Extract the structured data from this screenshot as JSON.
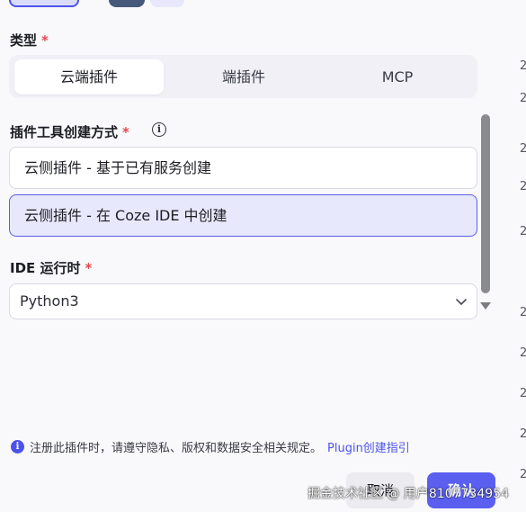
{
  "type_section": {
    "label": "类型",
    "required_mark": "*",
    "tabs": [
      {
        "label": "云端插件",
        "active": true
      },
      {
        "label": "端插件",
        "active": false
      },
      {
        "label": "MCP",
        "active": false
      }
    ]
  },
  "method_section": {
    "label": "插件工具创建方式",
    "required_mark": "*",
    "info_glyph": "i",
    "options": [
      {
        "label": "云侧插件 - 基于已有服务创建",
        "selected": false
      },
      {
        "label": "云侧插件 - 在 Coze IDE 中创建",
        "selected": true
      }
    ]
  },
  "runtime_section": {
    "label": "IDE 运行时",
    "required_mark": "*",
    "selected_value": "Python3"
  },
  "edge_digits": [
    "2",
    "2",
    "2",
    "2",
    "2",
    "2",
    "2",
    "2",
    "2",
    "2"
  ],
  "notice": {
    "icon_glyph": "i",
    "text": "注册此插件时，请遵守隐私、版权和数据安全相关规定。",
    "link": "Plugin创建指引"
  },
  "footer": {
    "cancel_label": "取消",
    "confirm_label": "确认"
  },
  "watermark": "掘金技术社区 @ 用户8107734954",
  "colors": {
    "accent": "#4d53e8",
    "required": "#e5484d",
    "confirm_bg": "#5a5ff0",
    "selected_bg": "#e8e8fc"
  }
}
